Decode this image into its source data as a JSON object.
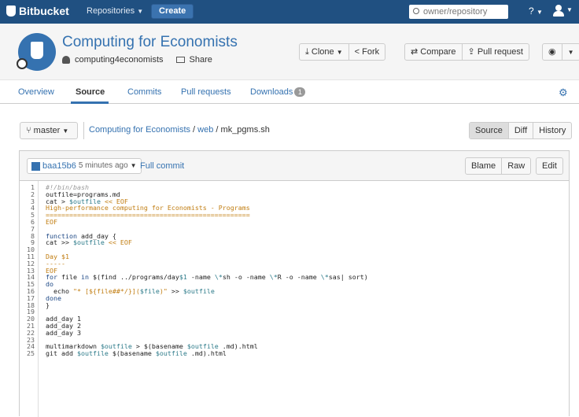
{
  "topbar": {
    "logo": "Bitbucket",
    "repositories_label": "Repositories",
    "create_label": "Create",
    "search_placeholder": "owner/repository",
    "help_label": "?"
  },
  "repo": {
    "title": "Computing for Economists",
    "owner": "computing4economists",
    "share_label": "Share",
    "clone_label": "Clone",
    "fork_label": "Fork",
    "compare_label": "Compare",
    "pull_request_label": "Pull request"
  },
  "tabs": [
    {
      "label": "Overview"
    },
    {
      "label": "Source"
    },
    {
      "label": "Commits"
    },
    {
      "label": "Pull requests"
    },
    {
      "label": "Downloads",
      "badge": "1"
    }
  ],
  "source": {
    "branch": "master",
    "path_repo": "Computing for Economists",
    "path_dir": "web",
    "path_file": "mk_pgms.sh",
    "views": [
      "Source",
      "Diff",
      "History"
    ]
  },
  "file": {
    "commit_hash": "baa15b6",
    "commit_time": "5 minutes ago",
    "full_commit_label": "Full commit",
    "blame_label": "Blame",
    "raw_label": "Raw",
    "edit_label": "Edit"
  },
  "code_lines": [
    [
      {
        "t": "#!/bin/bash",
        "c": "com"
      }
    ],
    [
      {
        "t": "outfile=programs.md",
        "c": "def"
      }
    ],
    [
      {
        "t": "cat > ",
        "c": "def"
      },
      {
        "t": "$outfile",
        "c": "var"
      },
      {
        "t": " << EOF",
        "c": "str"
      }
    ],
    [
      {
        "t": "High-performance computing for Economists - Programs",
        "c": "str"
      }
    ],
    [
      {
        "t": "====================================================",
        "c": "str"
      }
    ],
    [
      {
        "t": "EOF",
        "c": "str"
      }
    ],
    [
      {
        "t": "",
        "c": "def"
      }
    ],
    [
      {
        "t": "function",
        "c": "kw"
      },
      {
        "t": " add_day {",
        "c": "def"
      }
    ],
    [
      {
        "t": "cat >> ",
        "c": "def"
      },
      {
        "t": "$outfile",
        "c": "var"
      },
      {
        "t": " << EOF",
        "c": "str"
      }
    ],
    [
      {
        "t": "",
        "c": "def"
      }
    ],
    [
      {
        "t": "Day $1",
        "c": "str"
      }
    ],
    [
      {
        "t": "-----",
        "c": "str"
      }
    ],
    [
      {
        "t": "EOF",
        "c": "str"
      }
    ],
    [
      {
        "t": "for",
        "c": "kw"
      },
      {
        "t": " file ",
        "c": "def"
      },
      {
        "t": "in",
        "c": "kw"
      },
      {
        "t": " $(find ../programs/day",
        "c": "def"
      },
      {
        "t": "$1",
        "c": "var"
      },
      {
        "t": " -name ",
        "c": "def"
      },
      {
        "t": "\\*",
        "c": "var"
      },
      {
        "t": "sh -o -name ",
        "c": "def"
      },
      {
        "t": "\\*",
        "c": "var"
      },
      {
        "t": "R -o -name ",
        "c": "def"
      },
      {
        "t": "\\*",
        "c": "var"
      },
      {
        "t": "sas| sort)",
        "c": "def"
      }
    ],
    [
      {
        "t": "do",
        "c": "kw"
      }
    ],
    [
      {
        "t": "  echo ",
        "c": "def"
      },
      {
        "t": "\"* [${file##*/}](",
        "c": "str"
      },
      {
        "t": "$file",
        "c": "var"
      },
      {
        "t": ")\"",
        "c": "str"
      },
      {
        "t": " >> ",
        "c": "def"
      },
      {
        "t": "$outfile",
        "c": "var"
      }
    ],
    [
      {
        "t": "done",
        "c": "kw"
      }
    ],
    [
      {
        "t": "}",
        "c": "def"
      }
    ],
    [
      {
        "t": "",
        "c": "def"
      }
    ],
    [
      {
        "t": "add_day 1",
        "c": "def"
      }
    ],
    [
      {
        "t": "add_day 2",
        "c": "def"
      }
    ],
    [
      {
        "t": "add_day 3",
        "c": "def"
      }
    ],
    [
      {
        "t": "",
        "c": "def"
      }
    ],
    [
      {
        "t": "multimarkdown ",
        "c": "def"
      },
      {
        "t": "$outfile",
        "c": "var"
      },
      {
        "t": " > $(basename ",
        "c": "def"
      },
      {
        "t": "$outfile",
        "c": "var"
      },
      {
        "t": " .md).html",
        "c": "def"
      }
    ],
    [
      {
        "t": "git add ",
        "c": "def"
      },
      {
        "t": "$outfile",
        "c": "var"
      },
      {
        "t": " $(basename ",
        "c": "def"
      },
      {
        "t": "$outfile",
        "c": "var"
      },
      {
        "t": " .md).html",
        "c": "def"
      }
    ]
  ],
  "colors": {
    "topbar": "#205081",
    "link": "#3572b0"
  }
}
